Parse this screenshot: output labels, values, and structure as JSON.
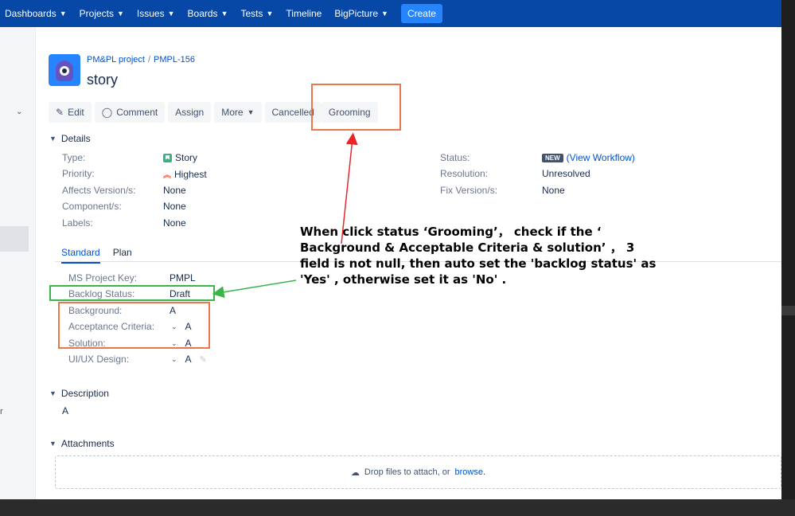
{
  "nav": {
    "items": [
      {
        "label": "Dashboards",
        "chevron": true
      },
      {
        "label": "Projects",
        "chevron": true
      },
      {
        "label": "Issues",
        "chevron": true
      },
      {
        "label": "Boards",
        "chevron": true
      },
      {
        "label": "Tests",
        "chevron": true
      },
      {
        "label": "Timeline",
        "chevron": false
      },
      {
        "label": "BigPicture",
        "chevron": true
      }
    ],
    "create_label": "Create"
  },
  "breadcrumb": {
    "project": "PM&PL project",
    "separator": "/",
    "issue_key": "PMPL-156"
  },
  "issue_title": "story",
  "toolbar": {
    "edit": "Edit",
    "comment": "Comment",
    "assign": "Assign",
    "more": "More",
    "cancelled": "Cancelled",
    "grooming": "Grooming"
  },
  "details": {
    "heading": "Details",
    "left": [
      {
        "label": "Type:",
        "value": "Story",
        "icon": "story-icon"
      },
      {
        "label": "Priority:",
        "value": "Highest",
        "icon": "priority-highest-icon"
      },
      {
        "label": "Affects Version/s:",
        "value": "None"
      },
      {
        "label": "Component/s:",
        "value": "None"
      },
      {
        "label": "Labels:",
        "value": "None"
      }
    ],
    "right": {
      "status_label": "Status:",
      "status_lozenge": "NEW",
      "status_link": "(View Workflow)",
      "resolution_label": "Resolution:",
      "resolution_value": "Unresolved",
      "fix_label": "Fix Version/s:",
      "fix_value": "None"
    }
  },
  "tabs": [
    "Standard",
    "Plan"
  ],
  "custom_fields": [
    {
      "label": "MS Project Key:",
      "value": "PMPL"
    },
    {
      "label": "Backlog Status:",
      "value": "Draft"
    },
    {
      "label": "Background:",
      "value": "A"
    },
    {
      "label": "Acceptance Criteria:",
      "value": "A"
    },
    {
      "label": "Solution:",
      "value": "A"
    },
    {
      "label": "UI/UX Design:",
      "value": "A"
    }
  ],
  "description": {
    "heading": "Description",
    "value": "A"
  },
  "attachments": {
    "heading": "Attachments",
    "drop_text": "Drop files to attach, or",
    "browse": "browse."
  },
  "sidebar": {
    "letter": "r"
  },
  "annotation": {
    "lines": [
      "When click status ‘Grooming’，  check if the ‘",
      "Background & Acceptable Criteria & solution’ ，  3",
      "field is not null, then auto set the 'backlog status' as",
      "'Yes' , otherwise set it as 'No' ."
    ]
  },
  "colors": {
    "nav_bg": "#0747a6",
    "create_bg": "#2684ff",
    "link": "#0052cc",
    "highlight_orange": "#e8784a",
    "highlight_green": "#3bb44a",
    "arrow_red": "#e8262a"
  }
}
